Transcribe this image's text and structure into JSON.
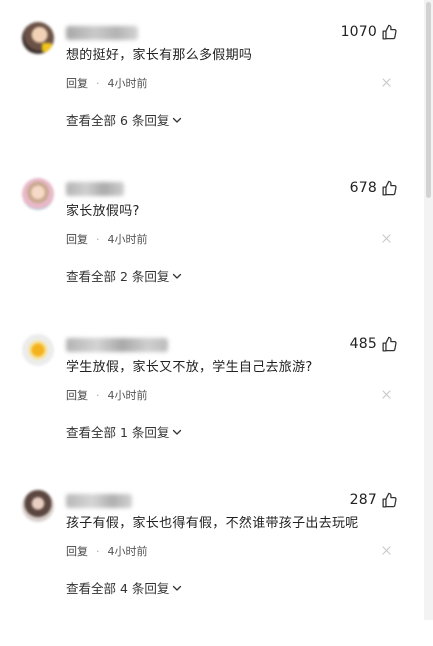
{
  "comments": [
    {
      "likes": "1070",
      "text": "想的挺好，家长有那么多假期吗",
      "reply_label": "回复",
      "separator": "·",
      "time": "4小时前",
      "expand_label": "查看全部 6 条回复"
    },
    {
      "likes": "678",
      "text": "家长放假吗?",
      "reply_label": "回复",
      "separator": "·",
      "time": "4小时前",
      "expand_label": "查看全部 2 条回复"
    },
    {
      "likes": "485",
      "text": "学生放假，家长又不放，学生自己去旅游?",
      "reply_label": "回复",
      "separator": "·",
      "time": "4小时前",
      "expand_label": "查看全部 1 条回复"
    },
    {
      "likes": "287",
      "text": "孩子有假，家长也得有假，不然谁带孩子出去玩呢",
      "reply_label": "回复",
      "separator": "·",
      "time": "4小时前",
      "expand_label": "查看全部 4 条回复"
    }
  ],
  "icons": {
    "like": "thumbs-up-icon",
    "dismiss": "close-icon",
    "expand": "chevron-down-icon"
  },
  "colors": {
    "text": "#222222",
    "meta": "#555555",
    "icon": "#333333",
    "scrollbar_thumb": "#d2d2d2"
  }
}
